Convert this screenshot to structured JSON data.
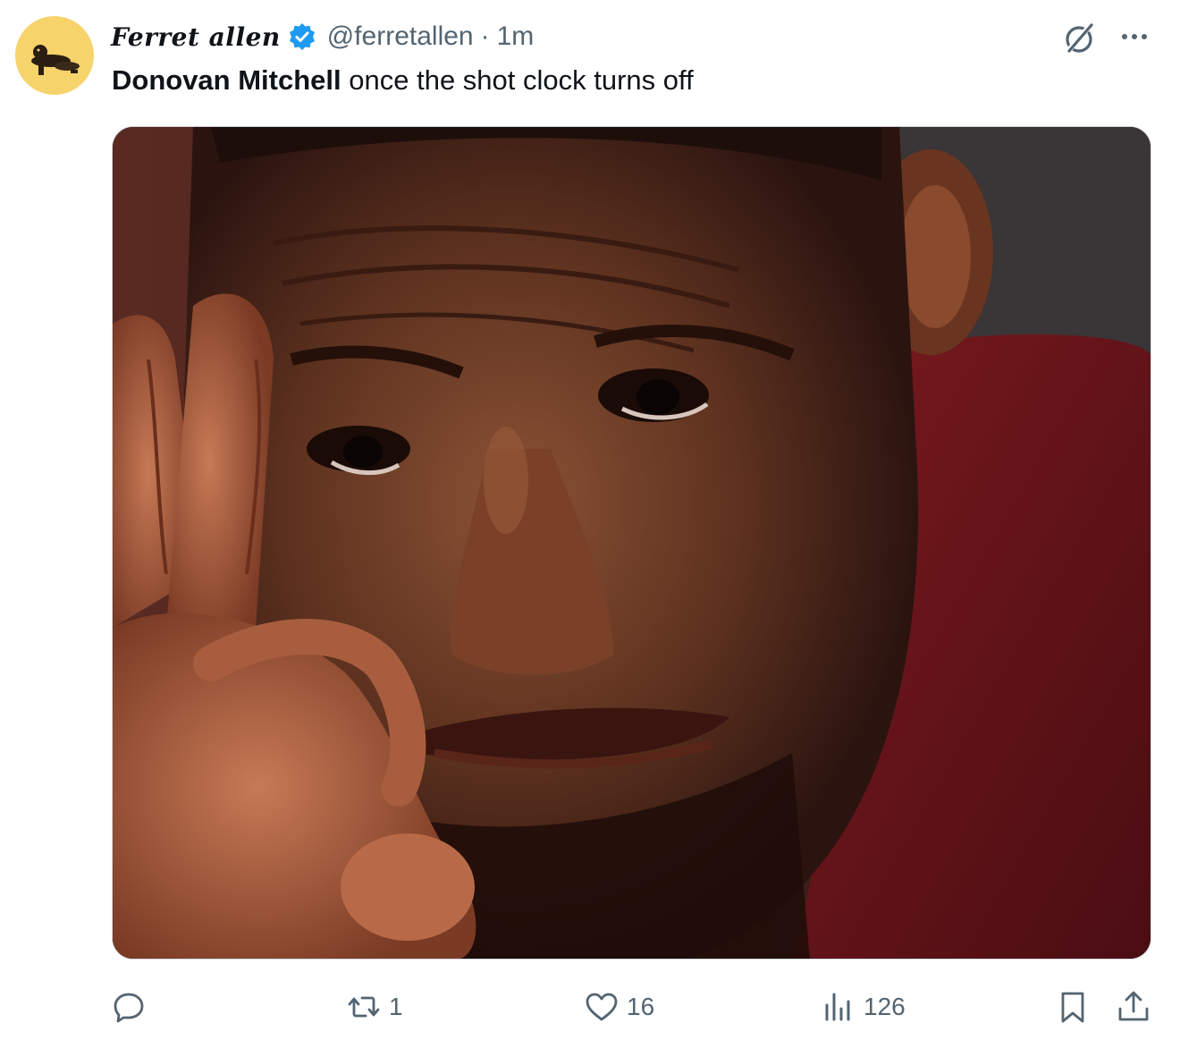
{
  "tweet": {
    "display_name": "Ferret allen",
    "handle": "@ferretallen",
    "separator": "·",
    "time": "1m",
    "text_bold": "Donovan Mitchell",
    "text_rest": " once the shot clock turns off"
  },
  "icons": {
    "verified": "verified-badge-icon",
    "grok": "grok-icon",
    "more": "more-dots-icon",
    "reply": "reply-icon",
    "retweet": "retweet-icon",
    "like": "heart-icon",
    "views": "views-bar-icon",
    "bookmark": "bookmark-icon",
    "share": "share-icon"
  },
  "metrics": {
    "retweets": "1",
    "likes": "16",
    "views": "126"
  },
  "colors": {
    "verified_blue": "#1d9bf0",
    "secondary_text": "#536471",
    "avatar_bg": "#f6d36b"
  }
}
